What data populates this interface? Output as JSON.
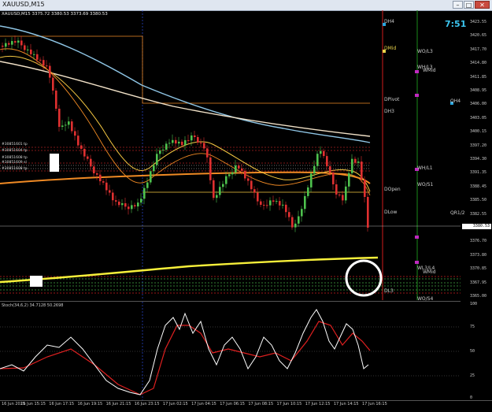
{
  "window": {
    "title": "XAUUSD,M15",
    "minimize_label": "–",
    "maximize_label": "□",
    "close_label": "✕"
  },
  "main": {
    "info": "XAUUSD,M15  3375.72 3380.53 3373.69 3380.53",
    "clock": "7:51",
    "current_price": "3380.53"
  },
  "price_axis": [
    "3423.55",
    "3420.65",
    "3417.70",
    "3414.80",
    "3411.85",
    "3408.95",
    "3406.00",
    "3403.05",
    "3400.15",
    "3397.20",
    "3394.30",
    "3391.35",
    "3388.45",
    "3385.50",
    "3382.55",
    "3379.65",
    "3376.70",
    "3373.80",
    "3370.85",
    "3367.95",
    "3365.00"
  ],
  "levels": [
    {
      "label": "DH4",
      "color": "#2aa7e0"
    },
    {
      "label": "DMid",
      "color": "#e8d24a"
    },
    {
      "label": "WO/L3",
      "color": "#cfcfcf"
    },
    {
      "label": "WH/L3",
      "color": "#cfcfcf"
    },
    {
      "label": "WMid",
      "color": "#cfcfcf"
    },
    {
      "label": "DPivot",
      "color": "#cfcfcf"
    },
    {
      "label": "DH3",
      "color": "#cfcfcf"
    },
    {
      "label": "QH4",
      "color": "#cfcfcf"
    },
    {
      "label": "WH/L1",
      "color": "#cfcfcf"
    },
    {
      "label": "DOpen",
      "color": "#cfcfcf"
    },
    {
      "label": "WO/S1",
      "color": "#cfcfcf"
    },
    {
      "label": "DLow",
      "color": "#cfcfcf"
    },
    {
      "label": "QR1/2",
      "color": "#cfcfcf"
    },
    {
      "label": "WL3/L4",
      "color": "#cfcfcf"
    },
    {
      "label": "WMid",
      "color": "#cfcfcf"
    },
    {
      "label": "DL3",
      "color": "#cfcfcf"
    },
    {
      "label": "WO/S4",
      "color": "#cfcfcf"
    }
  ],
  "orders": [
    "#30851601 tp",
    "#30851604 tp",
    "#30851608 tp",
    "#30851609 sl",
    "#30851608 tp"
  ],
  "stoch": {
    "label": "Stoch(34,6,2) 34.7128 50.2698",
    "levels": [
      "100",
      "75",
      "50",
      "25",
      "0"
    ]
  },
  "time_axis": [
    "16 Jun 2025",
    "16 Jun 15:15",
    "16 Jun 17:15",
    "16 Jun 19:15",
    "16 Jun 21:15",
    "16 Jun 23:15",
    "17 Jun 02:15",
    "17 Jun 04:15",
    "17 Jun 06:15",
    "17 Jun 08:15",
    "17 Jun 10:15",
    "17 Jun 12:15",
    "17 Jun 14:15",
    "17 Jun 16:15"
  ],
  "colors": {
    "background": "#000000",
    "bull": "#4ec24e",
    "bear": "#e03030",
    "ma_fast": "#f5c842",
    "ma_mid": "#f08a24",
    "ma_slow": "#8fc6e6",
    "ma_long": "#f2e2c8",
    "ma_200": "#f7f03a",
    "stoch_main": "#ffffff",
    "stoch_signal": "#e02020"
  }
}
